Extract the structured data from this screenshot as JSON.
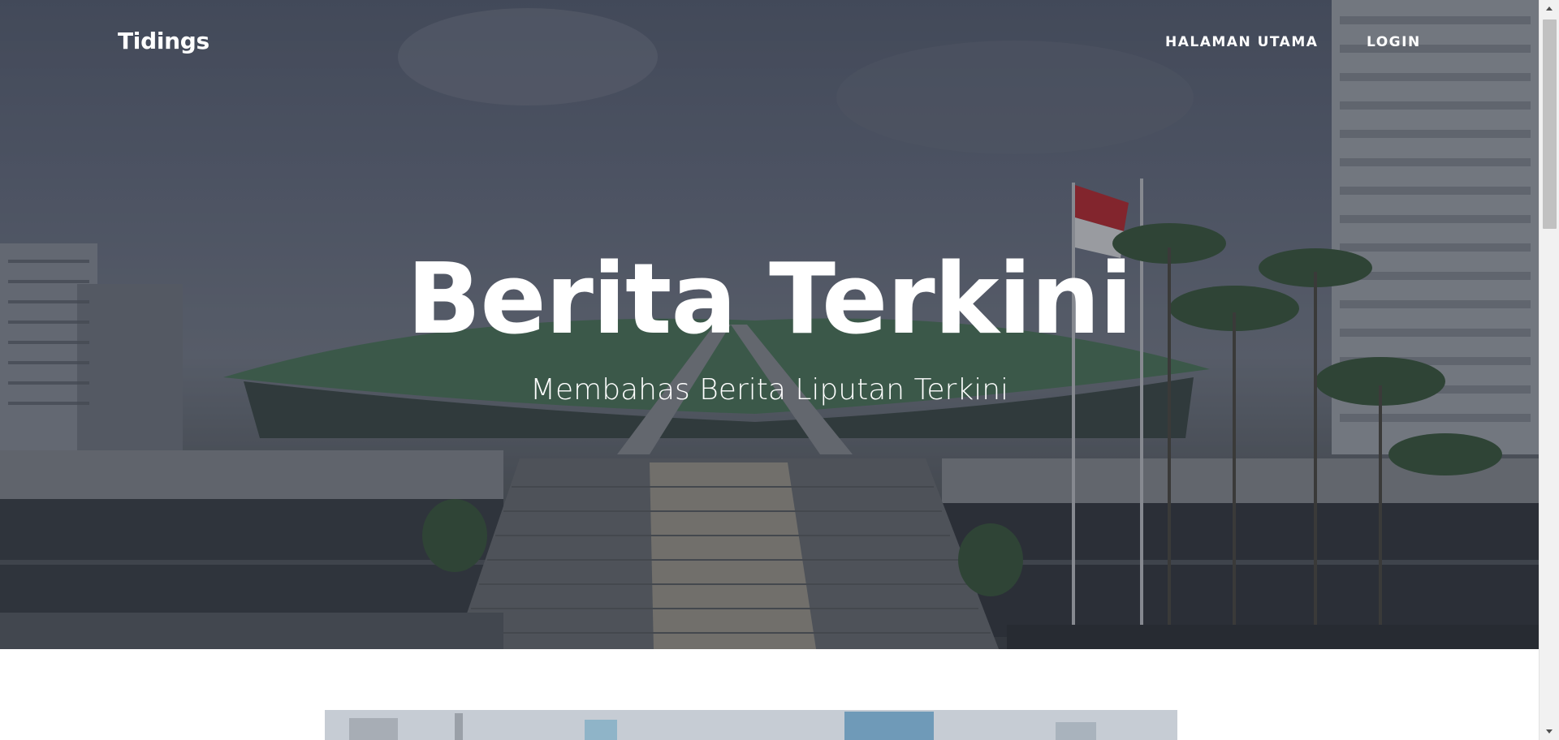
{
  "navbar": {
    "brand": "Tidings",
    "links": [
      {
        "label": "HALAMAN UTAMA"
      },
      {
        "label": "LOGIN"
      }
    ]
  },
  "hero": {
    "title": "Berita Terkini",
    "subtitle": "Membahas Berita Liputan Terkini",
    "background_image": "parliament-building-photo"
  },
  "article_preview": {
    "image": "city-skyline-photo"
  },
  "colors": {
    "hero_text": "#ffffff",
    "page_background": "#ffffff",
    "roof_green": "#4e7a5a",
    "flag_red": "#c0282d"
  }
}
